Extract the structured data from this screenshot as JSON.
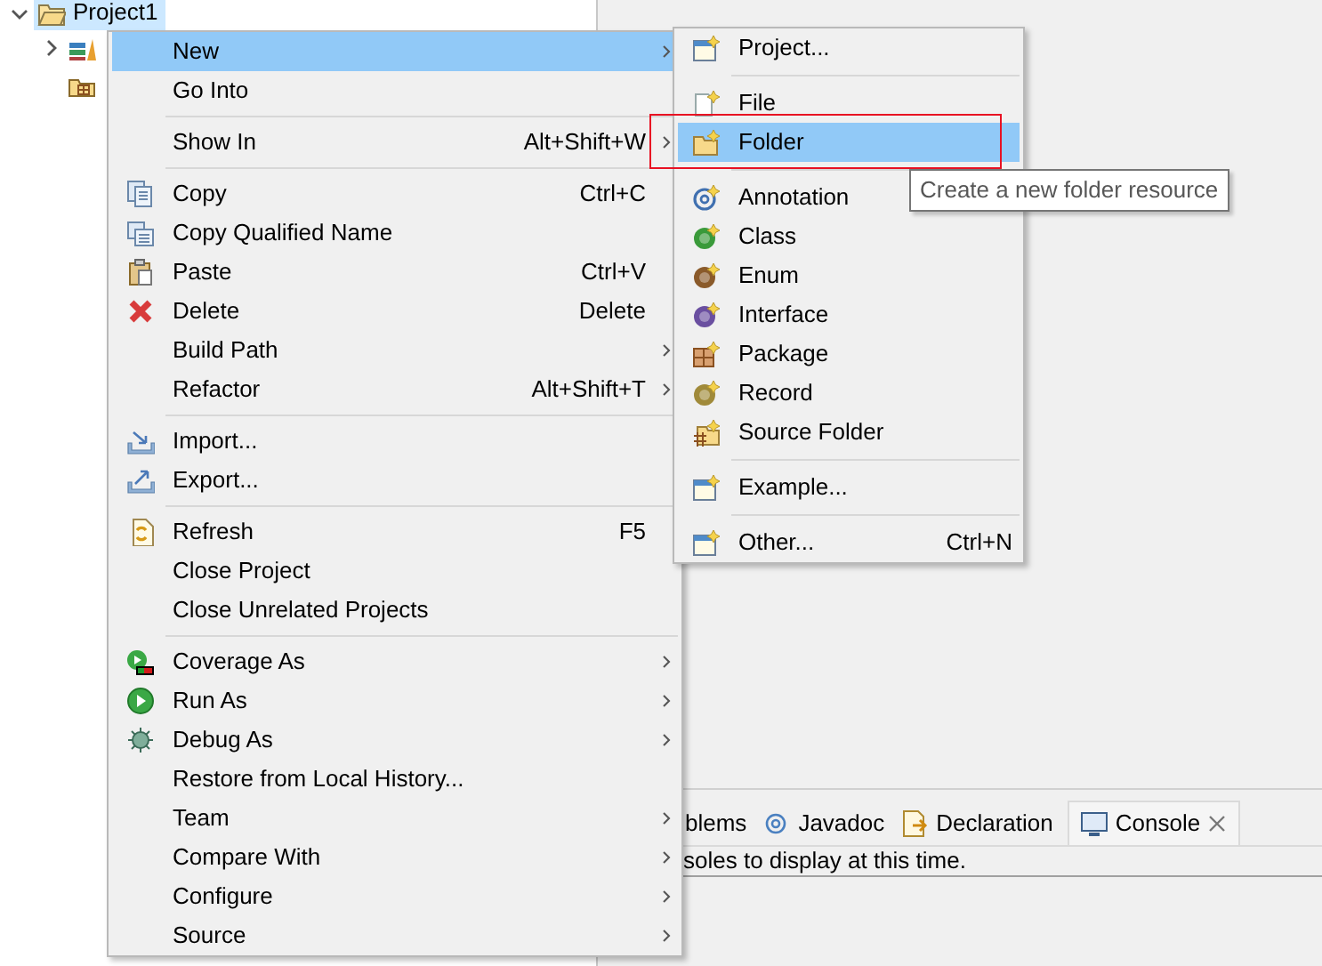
{
  "tree": {
    "items": [
      {
        "label": "Project1",
        "expanded": true,
        "selected": true,
        "children": [
          {
            "kind": "branch",
            "expanded": false
          },
          {
            "kind": "leaf"
          }
        ]
      }
    ]
  },
  "context_menu": {
    "items": [
      {
        "kind": "item",
        "label": "New",
        "submenu": true,
        "selected": true
      },
      {
        "kind": "item",
        "label": "Go Into"
      },
      {
        "kind": "separator"
      },
      {
        "kind": "item",
        "label": "Show In",
        "shortcut": "Alt+Shift+W",
        "submenu": true
      },
      {
        "kind": "separator"
      },
      {
        "kind": "item",
        "label": "Copy",
        "shortcut": "Ctrl+C"
      },
      {
        "kind": "item",
        "label": "Copy Qualified Name"
      },
      {
        "kind": "item",
        "label": "Paste",
        "shortcut": "Ctrl+V"
      },
      {
        "kind": "item",
        "label": "Delete",
        "shortcut": "Delete"
      },
      {
        "kind": "item",
        "label": "Build Path",
        "submenu": true
      },
      {
        "kind": "item",
        "label": "Refactor",
        "shortcut": "Alt+Shift+T",
        "submenu": true
      },
      {
        "kind": "separator"
      },
      {
        "kind": "item",
        "label": "Import..."
      },
      {
        "kind": "item",
        "label": "Export..."
      },
      {
        "kind": "separator"
      },
      {
        "kind": "item",
        "label": "Refresh",
        "shortcut": "F5"
      },
      {
        "kind": "item",
        "label": "Close Project"
      },
      {
        "kind": "item",
        "label": "Close Unrelated Projects"
      },
      {
        "kind": "separator"
      },
      {
        "kind": "item",
        "label": "Coverage As",
        "submenu": true
      },
      {
        "kind": "item",
        "label": "Run As",
        "submenu": true
      },
      {
        "kind": "item",
        "label": "Debug As",
        "submenu": true
      },
      {
        "kind": "item",
        "label": "Restore from Local History..."
      },
      {
        "kind": "item",
        "label": "Team",
        "submenu": true
      },
      {
        "kind": "item",
        "label": "Compare With",
        "submenu": true
      },
      {
        "kind": "item",
        "label": "Configure",
        "submenu": true
      },
      {
        "kind": "item",
        "label": "Source",
        "submenu": true
      }
    ]
  },
  "submenu": {
    "items": [
      {
        "kind": "item",
        "label": "Project..."
      },
      {
        "kind": "separator"
      },
      {
        "kind": "item",
        "label": "File"
      },
      {
        "kind": "item",
        "label": "Folder",
        "selected": true,
        "outlined": true
      },
      {
        "kind": "separator"
      },
      {
        "kind": "item",
        "label": "Annotation"
      },
      {
        "kind": "item",
        "label": "Class"
      },
      {
        "kind": "item",
        "label": "Enum"
      },
      {
        "kind": "item",
        "label": "Interface"
      },
      {
        "kind": "item",
        "label": "Package"
      },
      {
        "kind": "item",
        "label": "Record"
      },
      {
        "kind": "item",
        "label": "Source Folder"
      },
      {
        "kind": "separator"
      },
      {
        "kind": "item",
        "label": "Example..."
      },
      {
        "kind": "separator"
      },
      {
        "kind": "item",
        "label": "Other...",
        "shortcut": "Ctrl+N"
      }
    ]
  },
  "tooltip": {
    "text": "Create a new folder resource"
  },
  "bottom_panel": {
    "tabs": [
      {
        "label": "blems",
        "selected": false
      },
      {
        "label": "Javadoc",
        "selected": false
      },
      {
        "label": "Declaration",
        "selected": false
      },
      {
        "label": "Console",
        "selected": true,
        "closable": true
      }
    ],
    "message": "soles to display at this time."
  }
}
